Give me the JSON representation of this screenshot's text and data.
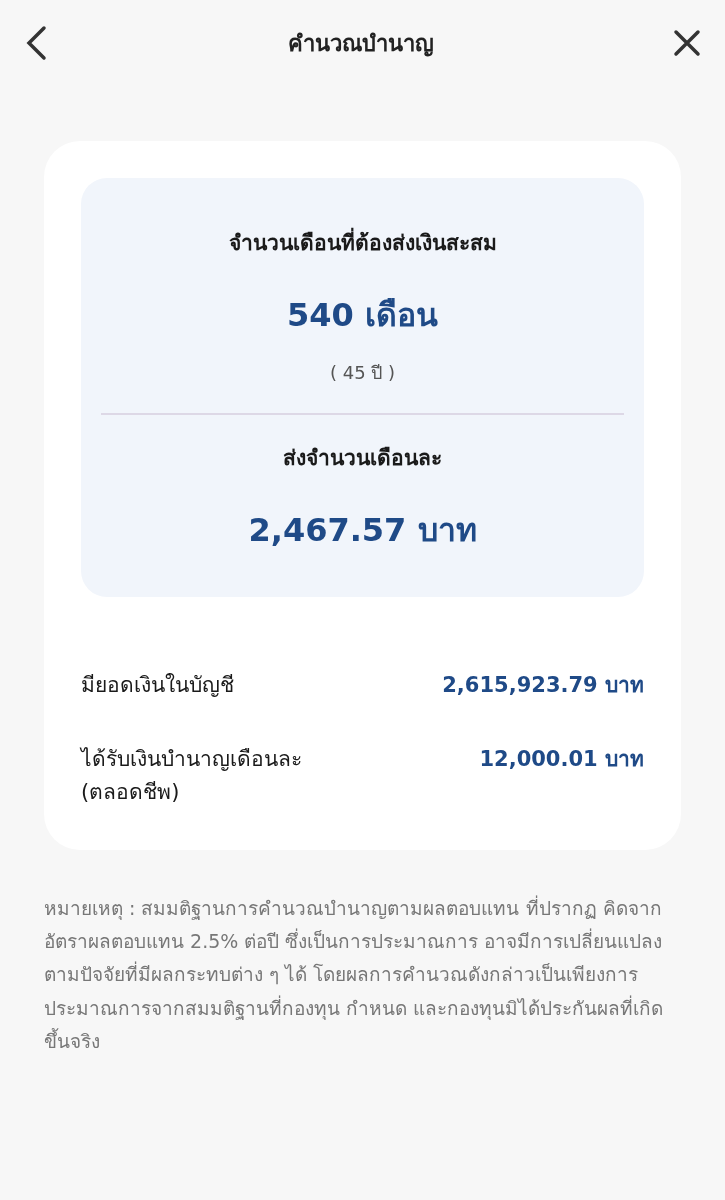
{
  "header": {
    "title": "คำนวณบำนาญ"
  },
  "summary": {
    "months_label": "จำนวนเดือนที่ต้องส่งเงินสะสม",
    "months_value": "540 เดือน",
    "years": "( 45 ปี )",
    "monthly_label": "ส่งจำนวนเดือนละ",
    "monthly_value": "2,467.57 บาท"
  },
  "details": [
    {
      "label": "มียอดเงินในบัญชี",
      "value": "2,615,923.79 บาท"
    },
    {
      "label": "ได้รับเงินบำนาญเดือนละ",
      "sublabel": "(ตลอดชีพ)",
      "value": "12,000.01 บาท"
    }
  ],
  "note": "หมายเหตุ : สมมติฐานการคำนวณบำนาญตามผลตอบแทน ที่ปรากฏ คิดจากอัตราผลตอบแทน 2.5% ต่อปี ซึ่งเป็นการประมาณการ อาจมีการเปลี่ยนแปลง ตามปัจจัยที่มีผลกระทบต่าง ๆ ได้ โดยผลการคำนวณดังกล่าวเป็นเพียงการประมาณการจากสมมติฐานที่กองทุน กำหนด และกองทุนมิได้ประกันผลที่เกิดขึ้นจริง"
}
